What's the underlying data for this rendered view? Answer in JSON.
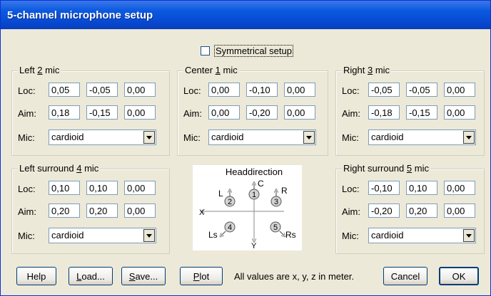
{
  "window": {
    "title": "5-channel microphone setup"
  },
  "symmetrical": {
    "label": "Symmetrical setup",
    "checked": false
  },
  "labels": {
    "loc": "Loc:",
    "aim": "Aim:",
    "mic": "Mic:"
  },
  "groups": {
    "left": {
      "legend_pre": "Left ",
      "legend_key": "2",
      "legend_post": " mic",
      "loc": [
        "0,05",
        "-0,05",
        "0,00"
      ],
      "aim": [
        "0,18",
        "-0,15",
        "0,00"
      ],
      "mic": "cardioid"
    },
    "center": {
      "legend_pre": "Center ",
      "legend_key": "1",
      "legend_post": " mic",
      "loc": [
        "0,00",
        "-0,10",
        "0,00"
      ],
      "aim": [
        "0,00",
        "-0,20",
        "0,00"
      ],
      "mic": "cardioid"
    },
    "right": {
      "legend_pre": "Right ",
      "legend_key": "3",
      "legend_post": " mic",
      "loc": [
        "-0,05",
        "-0,05",
        "0,00"
      ],
      "aim": [
        "-0,18",
        "-0,15",
        "0,00"
      ],
      "mic": "cardioid"
    },
    "left_surround": {
      "legend_pre": "Left surround ",
      "legend_key": "4",
      "legend_post": " mic",
      "loc": [
        "0,10",
        "0,10",
        "0,00"
      ],
      "aim": [
        "0,20",
        "0,20",
        "0,00"
      ],
      "mic": "cardioid"
    },
    "right_surround": {
      "legend_pre": "Right surround ",
      "legend_key": "5",
      "legend_post": " mic",
      "loc": [
        "-0,10",
        "0,10",
        "0,00"
      ],
      "aim": [
        "-0,20",
        "0,20",
        "0,00"
      ],
      "mic": "cardioid"
    }
  },
  "diagram": {
    "title": "Headdirection",
    "axis_x": "X",
    "axis_y": "Y",
    "mics": [
      {
        "number": "1",
        "label": "C"
      },
      {
        "number": "2",
        "label": "L"
      },
      {
        "number": "3",
        "label": "R"
      },
      {
        "number": "4",
        "label": "Ls"
      },
      {
        "number": "5",
        "label": "Rs"
      }
    ]
  },
  "buttons": {
    "help": "Help",
    "load_key": "L",
    "load_rest": "oad...",
    "save_key": "S",
    "save_rest": "ave...",
    "plot_key": "P",
    "plot_rest": "lot",
    "cancel": "Cancel",
    "ok": "OK"
  },
  "note": "All values are x, y, z in meter."
}
